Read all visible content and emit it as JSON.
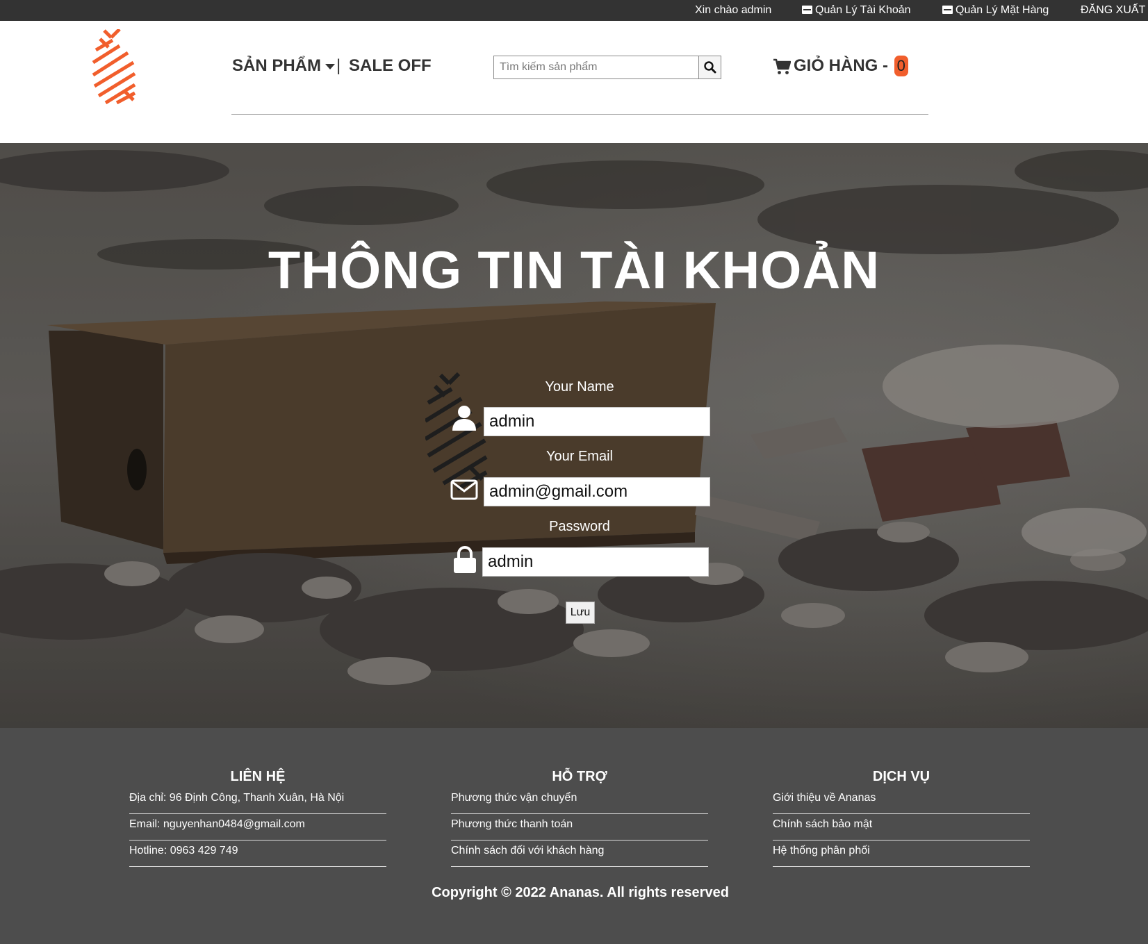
{
  "topbar": {
    "greeting": "Xin chào admin",
    "manage_account": "Quản Lý Tài Khoản",
    "manage_products": "Quản Lý Mặt Hàng",
    "logout": "ĐĂNG XUẤT"
  },
  "header": {
    "nav_products": "SẢN PHẨM",
    "nav_separator": "|",
    "nav_sale": "SALE OFF",
    "search_placeholder": "Tìm kiếm sản phẩm",
    "cart_label": "GIỎ HÀNG -",
    "cart_count": "0"
  },
  "hero": {
    "title": "THÔNG TIN TÀI KHOẢN"
  },
  "form": {
    "name_label": "Your Name",
    "name_value": "admin",
    "email_label": "Your Email",
    "email_value": "admin@gmail.com",
    "password_label": "Password",
    "password_value": "admin",
    "save_label": "Lưu"
  },
  "footer": {
    "columns": [
      {
        "heading": "LIÊN HỆ",
        "items": [
          "Địa chỉ: 96 Định Công, Thanh Xuân, Hà Nội",
          "Email: nguyenhan0484@gmail.com",
          "Hotline: 0963 429 749"
        ]
      },
      {
        "heading": "HỖ TRỢ",
        "items": [
          "Phương thức vận chuyển",
          "Phương thức thanh toán",
          "Chính sách đối với khách hàng"
        ]
      },
      {
        "heading": "DỊCH VỤ",
        "items": [
          "Giới thiệu về Ananas",
          "Chính sách bảo mật",
          "Hệ thống phân phối"
        ]
      }
    ],
    "copyright": "Copyright © 2022 Ananas. All rights reserved"
  },
  "colors": {
    "brand_orange": "#f15e2c",
    "topbar_bg": "#333333",
    "footer_bg": "#4d4d4d"
  },
  "icons": [
    "logo-icon",
    "store-icon",
    "caret-down-icon",
    "search-icon",
    "cart-icon",
    "user-icon",
    "envelope-icon",
    "lock-icon"
  ]
}
